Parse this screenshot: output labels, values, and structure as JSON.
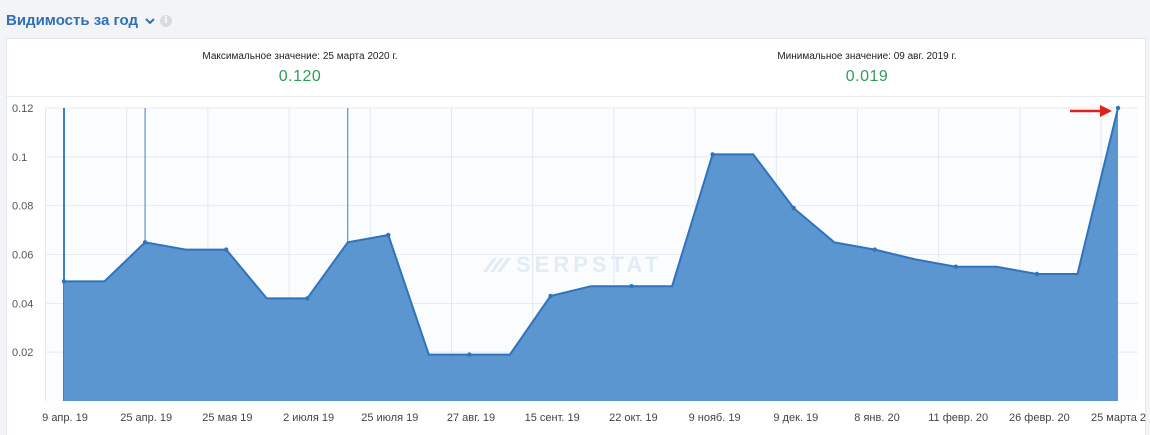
{
  "header": {
    "title": "Видимость за год",
    "icons": [
      "chevron-down-icon",
      "info-icon"
    ]
  },
  "stats": {
    "max_label": "Максимальное значение: 25 марта 2020 г.",
    "max_value": "0.120",
    "min_label": "Минимальное значение: 09 авг. 2019 г.",
    "min_value": "0.019"
  },
  "colors": {
    "accent": "#2f6fb8",
    "area": "#5b96d0",
    "line": "#2f73bd",
    "value_green": "#2e9c5a",
    "arrow": "#e0201c"
  },
  "watermark": "SERPSTAT",
  "chart_data": {
    "type": "area",
    "ylim": [
      0,
      0.12
    ],
    "yticks": [
      "0.02",
      "0.04",
      "0.06",
      "0.08",
      "0.1",
      "0.12"
    ],
    "ytick_values": [
      0.02,
      0.04,
      0.06,
      0.08,
      0.1,
      0.12
    ],
    "xtick_labels": [
      "9 апр. 19",
      "25 апр. 19",
      "25 мая 19",
      "2 июля 19",
      "25 июля 19",
      "27 авг. 19",
      "15 сент. 19",
      "22 окт. 19",
      "9 нояб. 19",
      "9 дек. 19",
      "8 янв. 20",
      "11 февр. 20",
      "26 февр. 20",
      "25 марта 2"
    ],
    "series": [
      {
        "values": [
          0.049,
          0.049,
          0.065,
          0.062,
          0.062,
          0.042,
          0.042,
          0.065,
          0.068,
          0.019,
          0.019,
          0.019,
          0.043,
          0.047,
          0.047,
          0.047,
          0.101,
          0.101,
          0.079,
          0.065,
          0.062,
          0.058,
          0.055,
          0.055,
          0.052,
          0.052,
          0.12
        ],
        "markers": [
          true,
          false,
          true,
          false,
          true,
          false,
          true,
          false,
          true,
          false,
          true,
          false,
          true,
          false,
          true,
          false,
          true,
          false,
          true,
          false,
          true,
          false,
          true,
          false,
          true,
          false,
          true
        ]
      }
    ],
    "event_lines_at_index": [
      0,
      2,
      7
    ],
    "grid": true,
    "annotation": "red arrow pointing to last point"
  }
}
